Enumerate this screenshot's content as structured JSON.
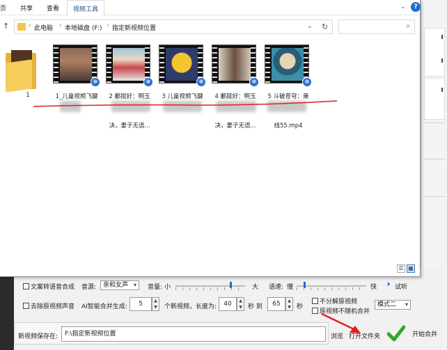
{
  "ribbon": {
    "tabs": [
      "页",
      "共享",
      "查看",
      "视频工具"
    ],
    "help_label": "?"
  },
  "address": {
    "crumbs": [
      "此电脑",
      "本地磁盘 (F:)",
      "指定新视频位置"
    ],
    "search_placeholder": ""
  },
  "files": {
    "folder": {
      "name": "1"
    },
    "videos": [
      {
        "line1": "1_儿童视频飞腱",
        "line2": ""
      },
      {
        "line1": "2 鄱挺好：明玉",
        "line2": "决，妻子无语..."
      },
      {
        "line1": "3 儿童视频飞腱",
        "line2": ""
      },
      {
        "line1": "4 鄱挺好：明玉",
        "line2": "决，妻子无语..."
      },
      {
        "line1": "5 斗破苍穹：萧",
        "line2": "线55.mp4"
      }
    ]
  },
  "panel": {
    "tts_checkbox": "文案转语音合成",
    "voice_label": "音源:",
    "voice_value": "亲和女声",
    "volume_label": "音量:",
    "volume_small": "小",
    "volume_large": "大",
    "speed_label": "语速:",
    "speed_slow": "慢",
    "speed_fast": "快",
    "listen_label": "试听",
    "remove_audio": "去除原视频声音",
    "ai_label": "AI智能合并生成:",
    "count_value": "5",
    "count_suffix": "个新视频，长度为:",
    "min_value": "40",
    "sec_to": "秒  到",
    "max_value": "65",
    "sec": "秒",
    "no_split": "不分解原视频",
    "no_random": "原视频不随机合并",
    "mode_value": "模式二",
    "save_label": "新视频保存在:",
    "save_path": "F:\\指定新视频位置",
    "browse_label": "浏览",
    "open_folder_label": "打开文件夹",
    "start_label": "开始合并"
  },
  "colors": {
    "accent": "#1f6fd1",
    "annotation_red": "#e02020",
    "folder_yellow": "#f4cd5c",
    "start_green": "#2fa52f"
  }
}
